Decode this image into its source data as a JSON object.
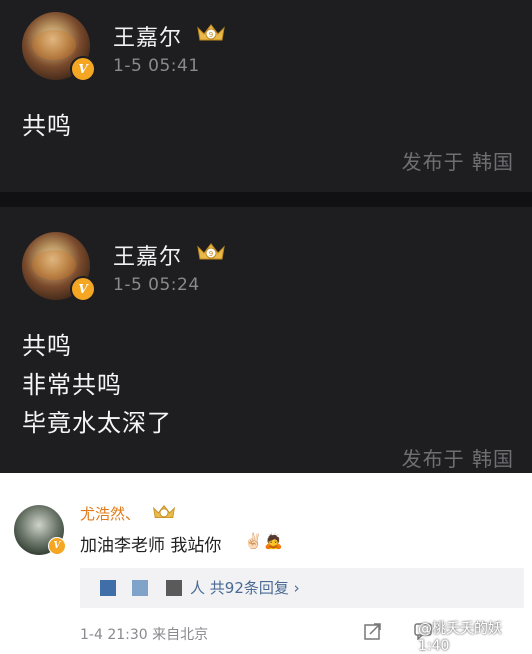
{
  "posts": [
    {
      "author": "王嘉尔",
      "crown_level": "9",
      "verified_mark": "V",
      "timestamp": "1-5 05:41",
      "lines": [
        "共鸣"
      ],
      "location": "发布于 韩国"
    },
    {
      "author": "王嘉尔",
      "crown_level": "9",
      "verified_mark": "V",
      "timestamp": "1-5 05:24",
      "lines": [
        "共鸣",
        "非常共鸣",
        "毕竟水太深了"
      ],
      "location": "发布于 韩国"
    }
  ],
  "comment": {
    "author": "尤浩然、",
    "verified_mark": "V",
    "text": "加油李老师 我站你",
    "emojis": [
      "✌🏻",
      "🙇"
    ],
    "reply_summary": {
      "suffix": "人",
      "count_label": "共92条回复",
      "chevron": "›"
    },
    "time_source": "1-4 21:30  来自北京",
    "icons": [
      "share-icon",
      "comment-icon"
    ]
  },
  "watermark": "@桃夭夭的妖 1:40",
  "colors": {
    "dark_bg": "#1e1e21",
    "name_orange": "#e07b18",
    "reply_blue": "#4a6a94",
    "badge_orange": "#f5a623"
  }
}
